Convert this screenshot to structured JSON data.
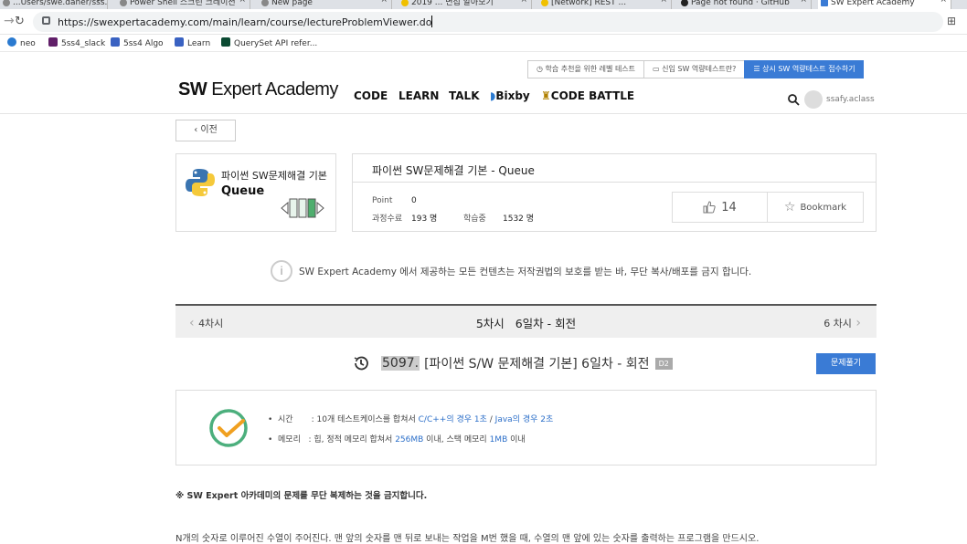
{
  "browser": {
    "tabs": [
      {
        "label": "...Users/swe.daner/sss..."
      },
      {
        "label": "Power Shell 스크린 크레이션"
      },
      {
        "label": "New page"
      },
      {
        "label": "2019 ... 면접 알아보기"
      },
      {
        "label": "[Network] REST ..."
      },
      {
        "label": "Page not found · GitHub"
      },
      {
        "label": "SW Expert Academy"
      }
    ],
    "url": "https://swexpertacademy.com/main/learn/course/lectureProblemViewer.do",
    "bookmarks": [
      "neo",
      "5ss4_slack",
      "5ss4 Algo",
      "Learn",
      "QuerySet API refer..."
    ]
  },
  "header": {
    "util": [
      "학습 추천을 위한 레벨 테스트",
      "신입 SW 역량테스트란?",
      "상시 SW 역량테스트 접수하기"
    ],
    "logo_bold": "SW",
    "logo_rest": " Expert Academy",
    "nav": [
      "CODE",
      "LEARN",
      "TALK",
      "Bixby",
      "CODE BATTLE"
    ],
    "username": "ssafy.aclass"
  },
  "prev_label": "이전",
  "course": {
    "title": "파이썬 SW문제해결 기본",
    "subtitle": "Queue"
  },
  "info": {
    "title": "파이썬 SW문제해결 기본 - Queue",
    "point_label": "Point",
    "point_value": "0",
    "complete_label": "과정수료",
    "complete_value": "193 명",
    "learning_label": "학습중",
    "learning_value": "1532 명",
    "likes": "14",
    "bookmark_label": "Bookmark"
  },
  "notice": "SW Expert Academy 에서 제공하는 모든 컨텐츠는 저작권법의 보호를 받는 바, 무단 복사/배포를 금지 합니다.",
  "stepnav": {
    "prev": "4차시",
    "title": "5차시   6일차 - 회전",
    "next": "6 차시"
  },
  "problem": {
    "number": "5097.",
    "name": "[파이썬 S/W 문제해결 기본] 6일차 - 회전",
    "level": "D2",
    "solve_button": "문제풀기"
  },
  "limits": {
    "time_label": "시간",
    "time_pre": ": 10개 테스트케이스를 합쳐서 ",
    "time_c": "C/C++의 경우 1초",
    "time_sep": " / ",
    "time_java": "Java의 경우 2초",
    "mem_label": "메모리",
    "mem_pre": ": 힙, 정적 메모리 합쳐서 ",
    "mem_heap": "256MB",
    "mem_mid": " 이내, 스택 메모리 ",
    "mem_stack": "1MB",
    "mem_post": " 이내"
  },
  "warning": "※ SW Expert 아카데미의 문제를 무단 복제하는 것을 금지합니다.",
  "description": "N개의 숫자로 이루어진 수열이 주어진다. 맨 앞의 숫자를 맨 뒤로 보내는 작업을 M번 했을 때, 수열의 맨 앞에 있는 숫자를 출력하는 프로그램을 만드시오.",
  "colors": {
    "accent": "#3a7bd5",
    "check": "#4caf7d",
    "check_mark": "#f0a020",
    "link": "#2c6fc9"
  }
}
